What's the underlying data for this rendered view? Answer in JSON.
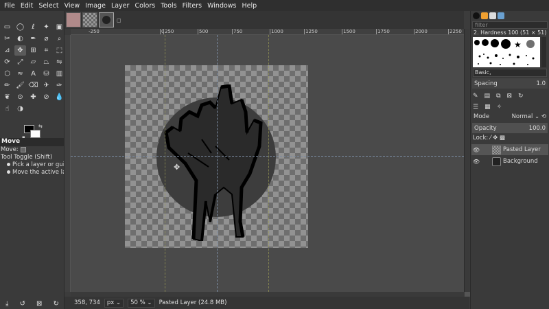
{
  "menubar": [
    "File",
    "Edit",
    "Select",
    "View",
    "Image",
    "Layer",
    "Colors",
    "Tools",
    "Filters",
    "Windows",
    "Help"
  ],
  "toolbox": {
    "tools": [
      "rect-select-icon",
      "ellipse-select-icon",
      "lasso-icon",
      "fuzzy-select-icon",
      "select-by-color-icon",
      "scissors-icon",
      "foreground-select-icon",
      "paths-icon",
      "color-picker-icon",
      "zoom-icon",
      "measure-icon",
      "move-icon",
      "align-icon",
      "crop-icon",
      "unified-transform-icon",
      "rotate-icon",
      "scale-icon",
      "shear-icon",
      "perspective-icon",
      "flip-icon",
      "cage-icon",
      "warp-icon",
      "text-icon",
      "bucket-fill-icon",
      "gradient-icon",
      "pencil-icon",
      "paintbrush-icon",
      "eraser-icon",
      "airbrush-icon",
      "ink-icon",
      "mypaint-brush-icon",
      "clone-icon",
      "heal-icon",
      "perspective-clone-icon",
      "blur-icon",
      "smudge-icon",
      "dodge-icon"
    ],
    "options_title": "Move",
    "move_label": "Move:",
    "tool_toggle": "Tool Toggle  (Shift)",
    "option_1": "Pick a layer or guide",
    "option_2": "Move the active layer"
  },
  "ruler_ticks": [
    "-250",
    "|0",
    "|250",
    "|500",
    "|750",
    "|1000",
    "|1250",
    "|1500",
    "|1750",
    "|2000",
    "|2250"
  ],
  "status": {
    "coords": "358, 734",
    "unit": "px",
    "zoom": "50 %",
    "message": "Pasted Layer (24.8 MB)"
  },
  "dock": {
    "filter_placeholder": "filter",
    "brush_name": "2. Hardness 100 (51 × 51)",
    "brush_tag": "Basic,",
    "spacing_label": "Spacing",
    "spacing_value": "1.0",
    "mode_label": "Mode",
    "mode_value": "Normal",
    "opacity_label": "Opacity",
    "opacity_value": "100.0",
    "lock_label": "Lock:",
    "layers": [
      {
        "name": "Pasted Layer",
        "selected": true
      },
      {
        "name": "Background",
        "selected": false
      }
    ]
  }
}
